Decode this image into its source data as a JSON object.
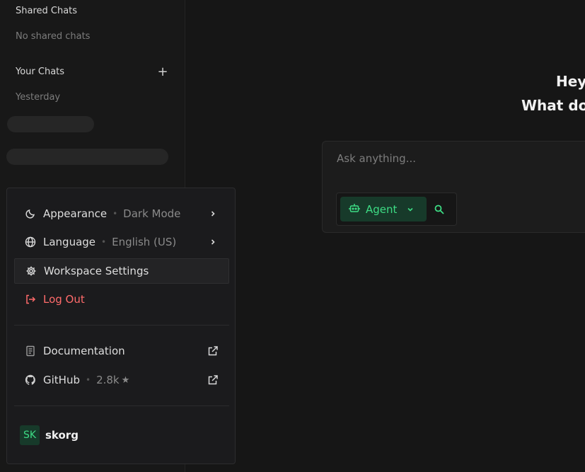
{
  "sidebar": {
    "shared_title": "Shared Chats",
    "shared_empty": "No shared chats",
    "your_title": "Your Chats",
    "add_label": "+",
    "group_label": "Yesterday"
  },
  "main": {
    "greeting_line1": "Hey,",
    "greeting_line2": "What do y",
    "input_placeholder": "Ask anything...",
    "agent_label": "Agent"
  },
  "menu": {
    "appearance": {
      "label": "Appearance",
      "value": "Dark Mode"
    },
    "language": {
      "label": "Language",
      "value": "English (US)"
    },
    "workspace_settings": "Workspace Settings",
    "logout": "Log Out",
    "documentation": "Documentation",
    "github": {
      "label": "GitHub",
      "stars": "2.8k"
    },
    "user": {
      "initials": "SK",
      "name": "skorg"
    }
  },
  "colors": {
    "accent": "#3ddc84",
    "danger": "#ff6b6b",
    "background": "#161616"
  },
  "icons": {
    "appearance": "moon-icon",
    "language": "globe-icon",
    "workspace": "gear-icon",
    "logout": "logout-icon",
    "documentation": "document-icon",
    "github": "github-icon",
    "external": "external-link-icon",
    "agent": "robot-icon",
    "search": "search-icon"
  }
}
